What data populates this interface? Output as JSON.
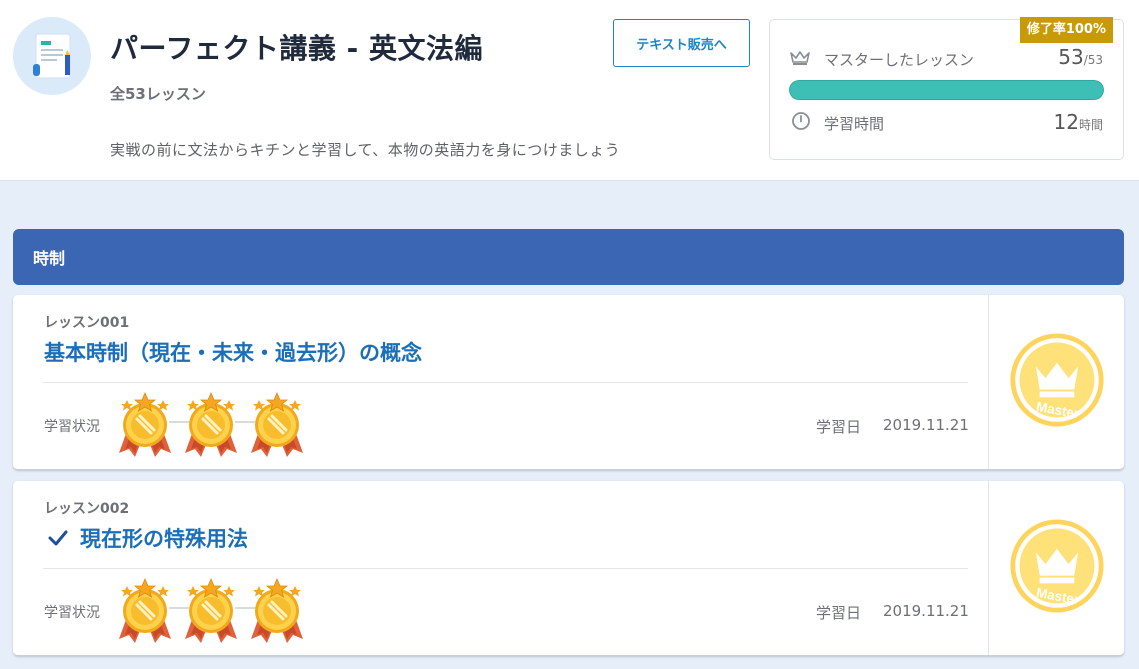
{
  "course": {
    "title": "パーフェクト講義 - 英文法編",
    "lesson_count": "全53レッスン",
    "description": "実戦の前に文法からキチンと学習して、本物の英語力を身につけましょう",
    "text_sale_button": "テキスト販売へ"
  },
  "progress": {
    "completion_badge": "修了率100%",
    "mastered_label": "マスターしたレッスン",
    "mastered_count": "53",
    "mastered_total": "/53",
    "mastered_fraction": 1.0,
    "study_time_label": "学習時間",
    "study_time_value": "12",
    "study_time_unit": "時間",
    "colors": {
      "bar": "#3ebfb6",
      "badge": "#c89a06"
    }
  },
  "section": {
    "title": "時制"
  },
  "lessons": [
    {
      "number": "レッスン001",
      "title": "基本時制（現在・未来・過去形）の概念",
      "checked": false,
      "status_label": "学習状況",
      "medals": 3,
      "date_label": "学習日",
      "date": "2019.11.21",
      "badge_text": "Master",
      "badge_icon": "crown-icon"
    },
    {
      "number": "レッスン002",
      "title": "現在形の特殊用法",
      "checked": true,
      "status_label": "学習状況",
      "medals": 3,
      "date_label": "学習日",
      "date": "2019.11.21",
      "badge_text": "Master",
      "badge_icon": "crown-icon"
    }
  ]
}
